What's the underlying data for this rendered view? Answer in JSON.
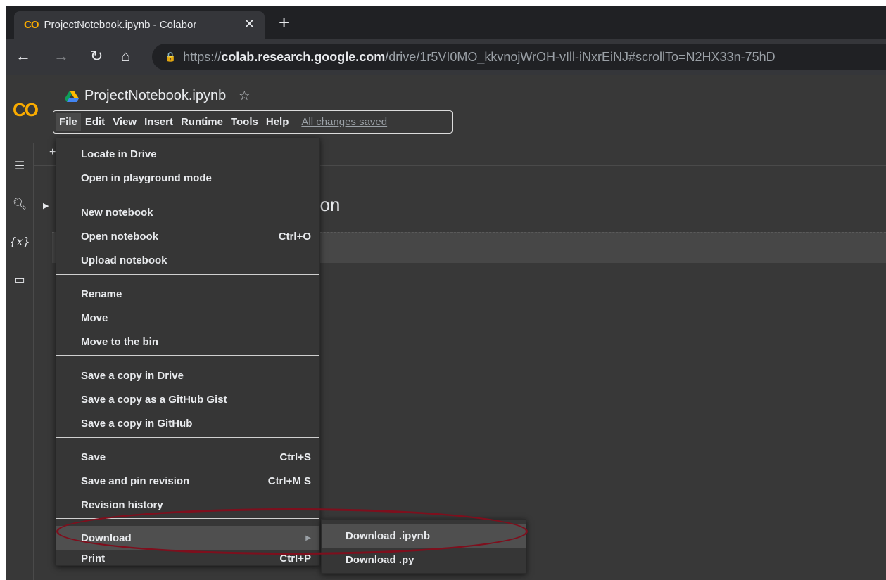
{
  "browser": {
    "tab_title": "ProjectNotebook.ipynb - Colabor",
    "tab_favicon": "CO",
    "url_scheme": "https://",
    "url_host": "colab.research.google.com",
    "url_path": "/drive/1r5VI0MO_kkvnojWrOH-vIll-iNxrEiNJ#scrollTo=N2HX33n-75hD"
  },
  "colab": {
    "logo": "CO",
    "notebook_title": "ProjectNotebook.ipynb",
    "menu": [
      "File",
      "Edit",
      "View",
      "Insert",
      "Runtime",
      "Tools",
      "Help"
    ],
    "save_status": "All changes saved",
    "heading_fragment": "hon",
    "sidebar_var_icon": "{x}"
  },
  "file_menu": {
    "items": [
      {
        "label": "Locate in Drive",
        "shortcut": ""
      },
      {
        "label": "Open in playground mode",
        "shortcut": ""
      },
      {
        "label": "New notebook",
        "shortcut": ""
      },
      {
        "label": "Open notebook",
        "shortcut": "Ctrl+O"
      },
      {
        "label": "Upload notebook",
        "shortcut": ""
      },
      {
        "label": "Rename",
        "shortcut": ""
      },
      {
        "label": "Move",
        "shortcut": ""
      },
      {
        "label": "Move to the bin",
        "shortcut": ""
      },
      {
        "label": "Save a copy in Drive",
        "shortcut": ""
      },
      {
        "label": "Save a copy as a GitHub Gist",
        "shortcut": ""
      },
      {
        "label": "Save a copy in GitHub",
        "shortcut": ""
      },
      {
        "label": "Save",
        "shortcut": "Ctrl+S"
      },
      {
        "label": "Save and pin revision",
        "shortcut": "Ctrl+M S"
      },
      {
        "label": "Revision history",
        "shortcut": ""
      },
      {
        "label": "Download",
        "shortcut": ""
      },
      {
        "label": "Print",
        "shortcut": "Ctrl+P"
      }
    ]
  },
  "download_submenu": {
    "items": [
      "Download .ipynb",
      "Download .py"
    ]
  },
  "colors": {
    "accent": "#f9ab00",
    "highlight": "#7e0f1d",
    "background": "#383838"
  }
}
